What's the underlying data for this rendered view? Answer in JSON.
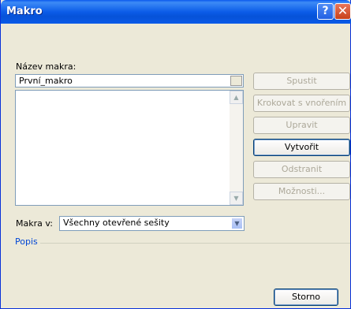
{
  "window": {
    "title": "Makro",
    "help_glyph": "?",
    "close_glyph": "✕"
  },
  "macro_name": {
    "label": "Název makra:",
    "value": "První_makro"
  },
  "macros_in": {
    "label": "Makra v:",
    "value": "Všechny otevřené sešity"
  },
  "description": {
    "label": "Popis"
  },
  "buttons": {
    "run": "Spustit",
    "step_into": "Krokovat s vnořením",
    "edit": "Upravit",
    "create": "Vytvořit",
    "delete": "Odstranit",
    "options": "Možnosti...",
    "cancel": "Storno"
  }
}
